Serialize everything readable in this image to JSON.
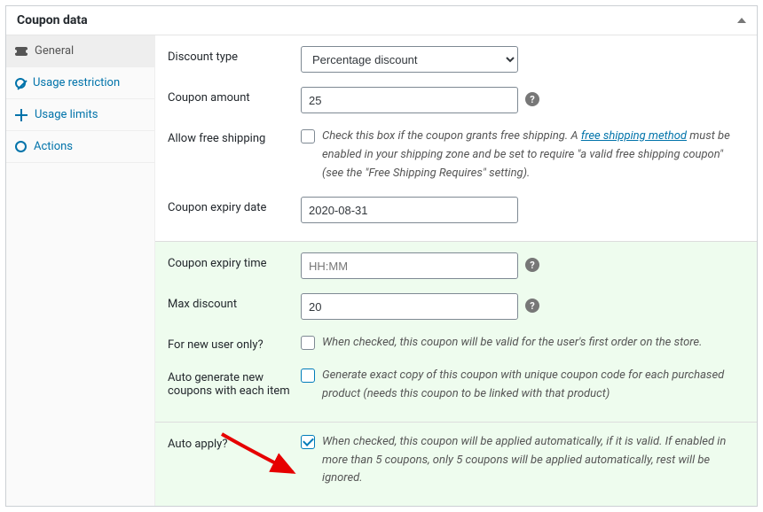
{
  "header": {
    "title": "Coupon data"
  },
  "tabs": {
    "general": "General",
    "usage_restriction": "Usage restriction",
    "usage_limits": "Usage limits",
    "actions": "Actions"
  },
  "fields": {
    "discount_type": {
      "label": "Discount type",
      "value": "Percentage discount"
    },
    "coupon_amount": {
      "label": "Coupon amount",
      "value": "25"
    },
    "free_shipping": {
      "label": "Allow free shipping",
      "desc_before": "Check this box if the coupon grants free shipping. A ",
      "link": "free shipping method",
      "desc_after": " must be enabled in your shipping zone and be set to require \"a valid free shipping coupon\" (see the \"Free Shipping Requires\" setting)."
    },
    "expiry_date": {
      "label": "Coupon expiry date",
      "value": "2020-08-31"
    },
    "expiry_time": {
      "label": "Coupon expiry time",
      "placeholder": "HH:MM"
    },
    "max_discount": {
      "label": "Max discount",
      "value": "20"
    },
    "new_user_only": {
      "label": "For new user only?",
      "desc": "When checked, this coupon will be valid for the user's first order on the store."
    },
    "auto_generate": {
      "label": "Auto generate new coupons with each item",
      "desc": "Generate exact copy of this coupon with unique coupon code for each purchased product (needs this coupon to be linked with that product)"
    },
    "auto_apply": {
      "label": "Auto apply?",
      "desc": "When checked, this coupon will be applied automatically, if it is valid. If enabled in more than 5 coupons, only 5 coupons will be applied automatically, rest will be ignored.",
      "checked": true
    }
  }
}
